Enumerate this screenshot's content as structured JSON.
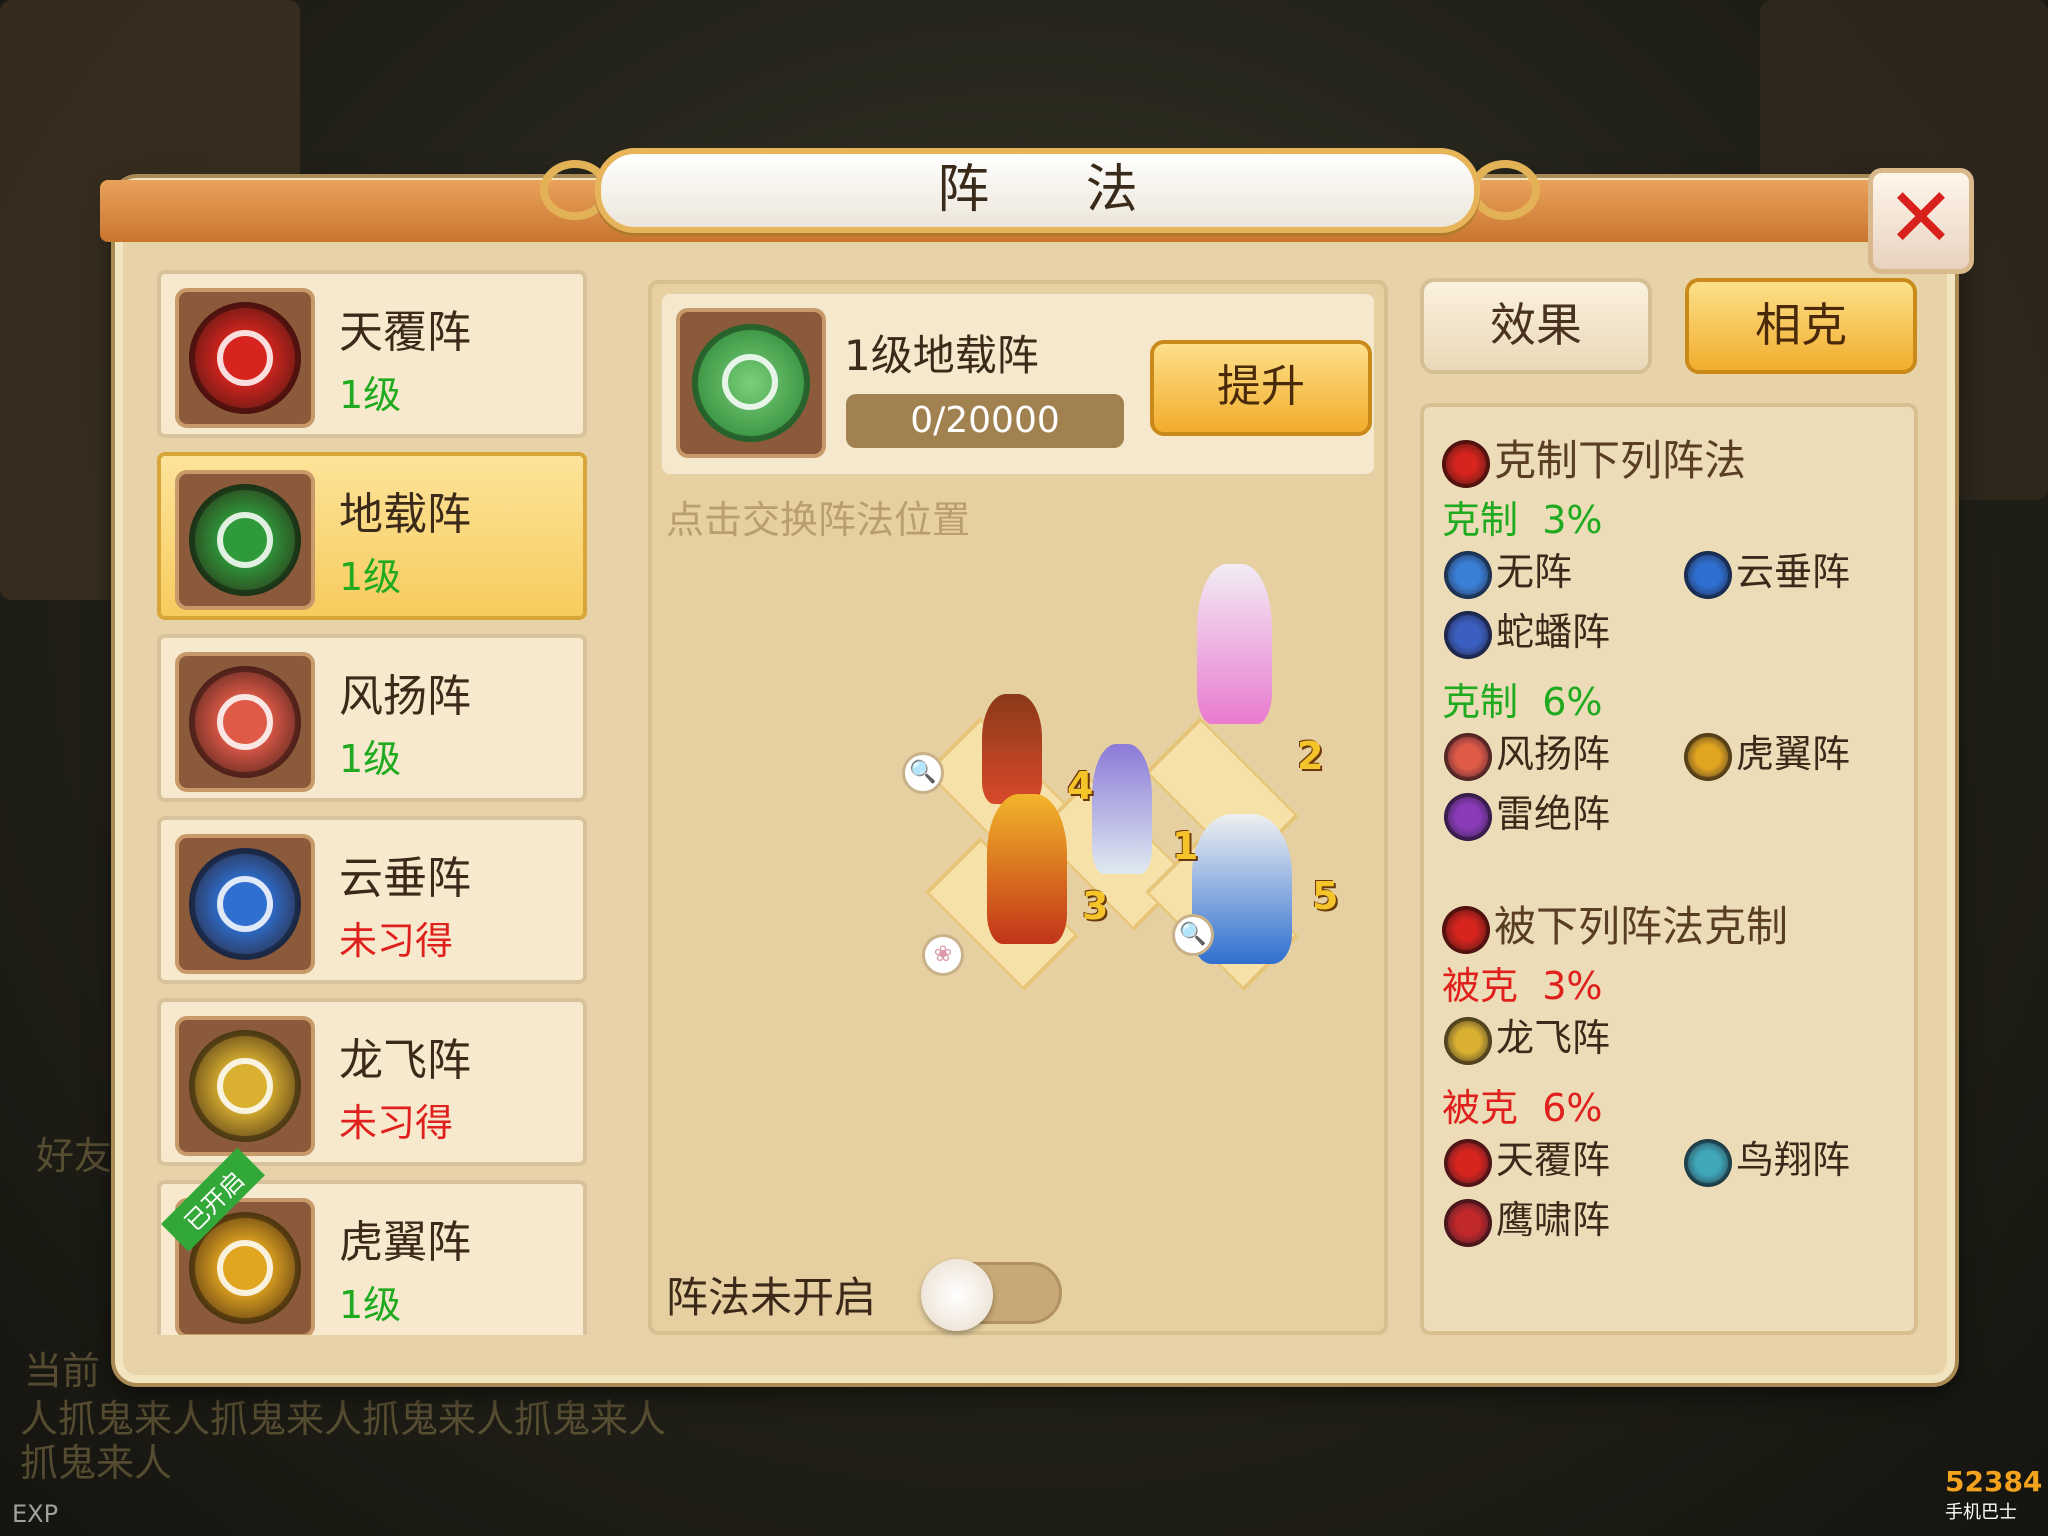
{
  "window": {
    "title": "阵 法",
    "close_icon": "close-icon"
  },
  "formation_list": [
    {
      "name": "天覆阵",
      "level": "1级",
      "status": "learned",
      "icon": "tianfu-icon",
      "color": "#d8241e"
    },
    {
      "name": "地载阵",
      "level": "1级",
      "status": "learned",
      "icon": "dizai-icon",
      "color": "#2f9a3a",
      "selected": true
    },
    {
      "name": "风扬阵",
      "level": "1级",
      "status": "learned",
      "icon": "fengyang-icon",
      "color": "#e05a48"
    },
    {
      "name": "云垂阵",
      "level": "未习得",
      "status": "unlearned",
      "icon": "yunchui-icon",
      "color": "#2f6fd0"
    },
    {
      "name": "龙飞阵",
      "level": "未习得",
      "status": "unlearned",
      "icon": "longfei-icon",
      "color": "#d9b030"
    },
    {
      "name": "虎翼阵",
      "level": "1级",
      "status": "learned",
      "icon": "huyi-icon",
      "color": "#e2a520",
      "badge": "已开启"
    }
  ],
  "detail": {
    "title": "1级地载阵",
    "exp": "0/20000",
    "exp_progress": 0,
    "upgrade_label": "提升",
    "hint": "点击交换阵法位置",
    "toggle_label": "阵法未开启",
    "toggle_on": false,
    "positions": [
      "1",
      "2",
      "3",
      "4",
      "5"
    ]
  },
  "tabs": {
    "effect": "效果",
    "counter": "相克"
  },
  "counters": {
    "beats_title": "克制下列阵法",
    "beats": [
      {
        "label": "克制",
        "pct": "3%",
        "items": [
          {
            "name": "无阵",
            "icon": "wu-icon",
            "color": "#3a7fd6"
          },
          {
            "name": "云垂阵",
            "icon": "yunchui-icon",
            "color": "#2f6fd0"
          },
          {
            "name": "蛇蟠阵",
            "icon": "shepan-icon",
            "color": "#3b5fc0"
          }
        ]
      },
      {
        "label": "克制",
        "pct": "6%",
        "items": [
          {
            "name": "风扬阵",
            "icon": "fengyang-icon",
            "color": "#e05a48"
          },
          {
            "name": "虎翼阵",
            "icon": "huyi-icon",
            "color": "#e2a520"
          },
          {
            "name": "雷绝阵",
            "icon": "leijue-icon",
            "color": "#8a3bb8"
          }
        ]
      }
    ],
    "beaten_title": "被下列阵法克制",
    "beaten": [
      {
        "label": "被克",
        "pct": "3%",
        "items": [
          {
            "name": "龙飞阵",
            "icon": "longfei-icon",
            "color": "#d9b030"
          }
        ]
      },
      {
        "label": "被克",
        "pct": "6%",
        "items": [
          {
            "name": "天覆阵",
            "icon": "tianfu-icon",
            "color": "#d8241e"
          },
          {
            "name": "鸟翔阵",
            "icon": "niaoxiang-icon",
            "color": "#3fa7b8"
          },
          {
            "name": "鹰啸阵",
            "icon": "yingxiao-icon",
            "color": "#c0282a"
          }
        ]
      }
    ]
  },
  "background": {
    "chat_line1": "人抓鬼来人抓鬼来人抓鬼来人抓鬼来人",
    "chat_line2": "抓鬼来人",
    "current_label": "当前",
    "friends_label": "好友",
    "exp_label": "EXP",
    "watermark": "52384",
    "watermark_sub": "手机巴士"
  }
}
